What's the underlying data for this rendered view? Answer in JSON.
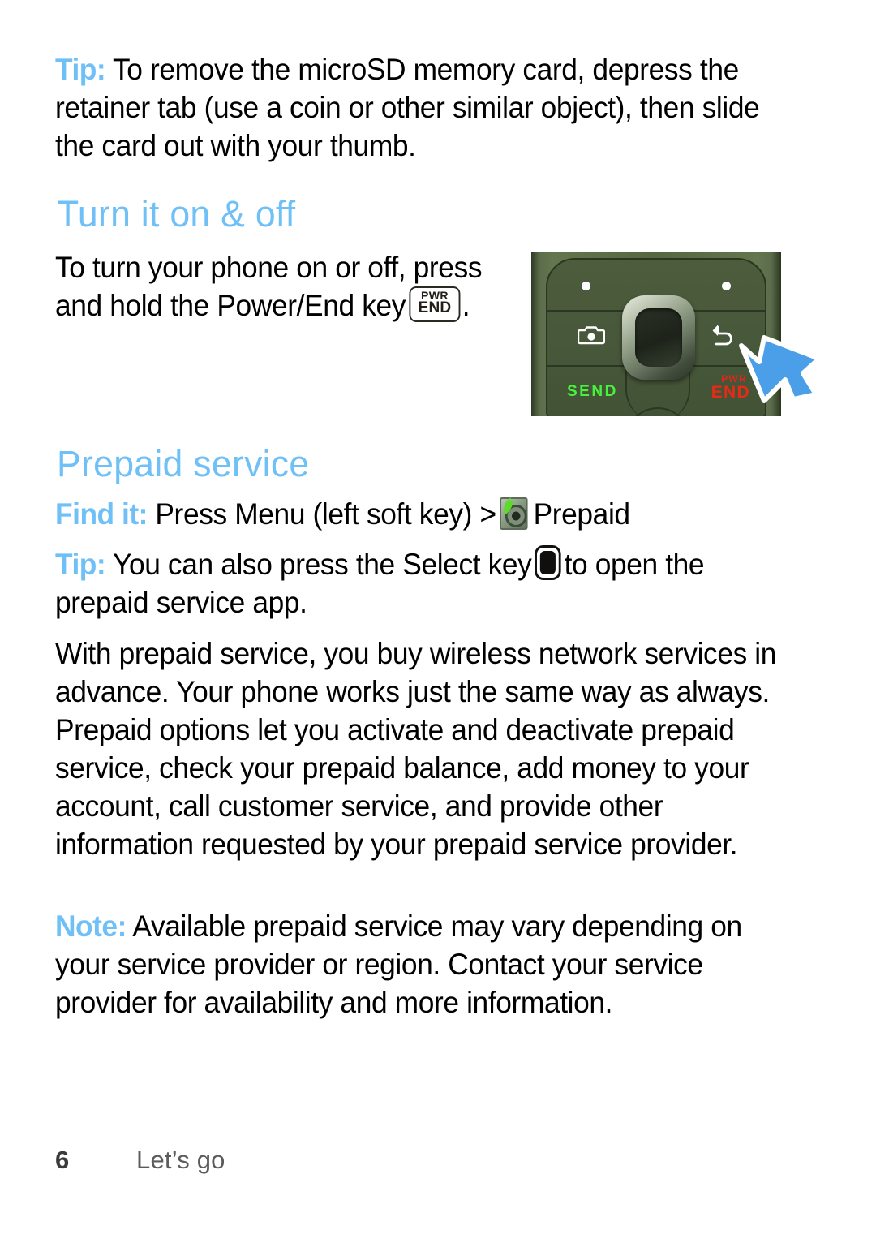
{
  "page": {
    "number": "6",
    "section": "Let’s go"
  },
  "colors": {
    "heading_blue": "#6fc0f7",
    "lead_blue": "#6fc0f7",
    "send_green": "#49f03c",
    "end_red": "#e52a18",
    "arrow_blue": "#4a9fe8",
    "keypad_green": "#4c5c3c"
  },
  "tip_microsd": {
    "lead": "Tip:",
    "text": "To remove the microSD memory card, depress the retainer tab (use a coin or other similar object), then slide the card out with your thumb."
  },
  "turn_on_off": {
    "heading": "Turn it on & off",
    "text_before_key": "To turn your phone on or off, press and hold the Power/End key",
    "text_after_key": ".",
    "key_glyph": {
      "name": "pwr-end-key-icon",
      "line1": "PWR",
      "line2": "END"
    }
  },
  "phone_art": {
    "alt": "phone keypad with Power/End key highlighted",
    "labels": {
      "send": "SEND",
      "pwr": "PWR",
      "end": "END"
    },
    "icons": {
      "camera": "camera-icon",
      "back": "back-arrow-icon",
      "navigation_pad": "navigation-pad",
      "callout": "callout-arrow-icon"
    }
  },
  "prepaid_service": {
    "heading": "Prepaid service",
    "find_it": {
      "lead": "Find it:",
      "text_before_icon": "Press Menu (left soft key) >",
      "icon_name": "prepaid-app-icon",
      "text_after_icon": "Prepaid"
    },
    "tip": {
      "lead": "Tip:",
      "text_before_key": "You can also press the Select key",
      "key_icon_name": "select-key-icon",
      "text_after_key": "to open the prepaid service app."
    },
    "body": "With prepaid service, you buy wireless network services in advance. Your phone works just the same way as always. Prepaid options let you activate and deactivate prepaid service, check your prepaid balance, add money to your account, call customer service, and provide other information requested by your prepaid service provider.",
    "note": {
      "lead": "Note:",
      "text": "Available prepaid service may vary depending on your service provider or region. Contact your service provider for availability and more information."
    }
  }
}
